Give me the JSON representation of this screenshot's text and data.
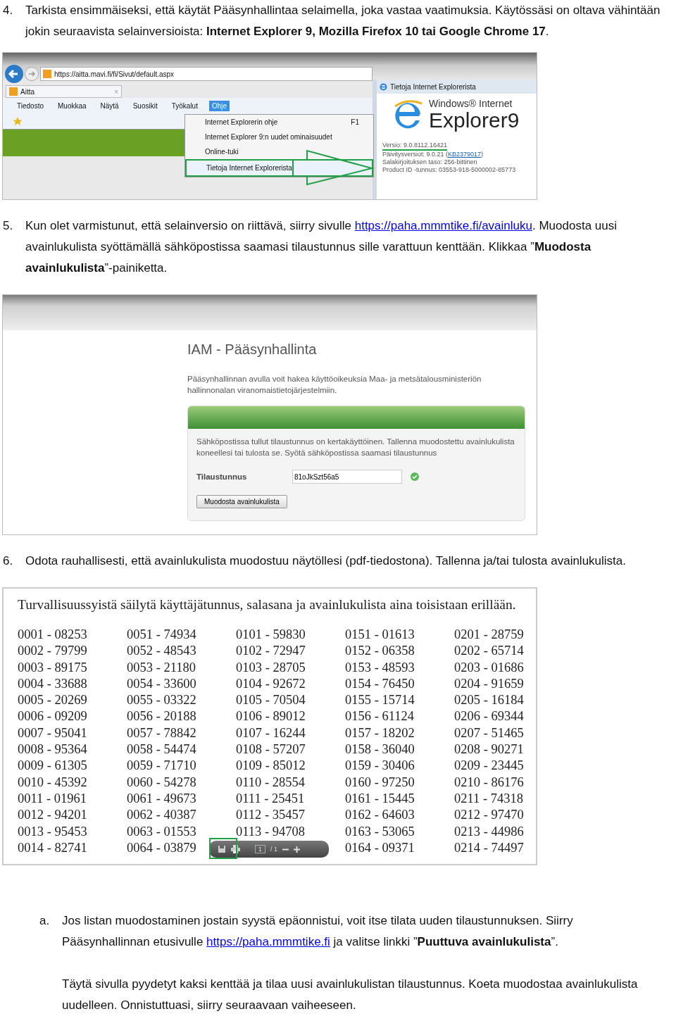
{
  "step_4": {
    "number": "4.",
    "parts": [
      {
        "kind": "text",
        "text": "Tarkista ensimmäiseksi, että käytät Pääsynhallintaa selaimella, joka vastaa vaatimuksia. Käytössäsi on oltava vähintään jokin seuraavista selainversioista: **Internet Explorer 9, Mozilla Firefox 10 tai Google Chrome 17**."
      }
    ]
  },
  "browser_screenshot": {
    "url": "https://aitta.mavi.fi/fi/Sivut/default.aspx",
    "tab": "Aitta",
    "tab_close": "×",
    "menu": [
      {
        "label": "Tiedosto",
        "selected": false
      },
      {
        "label": "Muokkaa",
        "selected": false
      },
      {
        "label": "Näytä",
        "selected": false
      },
      {
        "label": "Suosikit",
        "selected": false
      },
      {
        "label": "Työkalut",
        "selected": false
      },
      {
        "label": "Ohje",
        "selected": true
      }
    ],
    "dropdown": [
      {
        "label": "Internet Explorerin ohje",
        "shortcut": "F1",
        "highlighted": false
      },
      {
        "label": "Internet Explorer 9:n uudet ominaisuudet",
        "highlighted": false
      },
      {
        "label": "Online-tuki",
        "highlighted": false
      },
      {
        "label": "Tietoja Internet Explorerista",
        "highlighted": true
      }
    ],
    "about_dialog": {
      "title": "Tietoja Internet Explorerista",
      "logo_small": "Windows® Internet",
      "logo_large": "Explorer9",
      "version": "Versio: 9.0.8112.16421",
      "updates": "Päivitysversiot: 9.0.21 (",
      "updates_link": "KB2379017",
      "updates_end": ")",
      "encryption": "Salakirjoituksen taso: 256-bittinen",
      "product_id": "Product ID -tunnus: 03553-918-5000002-85773"
    }
  },
  "step_5": {
    "number": "5.",
    "parts": [
      {
        "kind": "text",
        "text": "Kun olet varmistunut, että selainversio on riittävä, siirry sivulle "
      },
      {
        "kind": "link",
        "text": "https://paha.mmmtike.fi/avainluku"
      },
      {
        "kind": "text",
        "text": ". Muodosta uusi avainlukulista syöttämällä sähköpostissa saamasi tilaustunnus sille varattuun kenttään. Klikkaa ”**Muodosta avainlukulista**”-painiketta."
      }
    ]
  },
  "iam_screenshot": {
    "title": "IAM - Pääsynhallinta",
    "intro": "Pääsynhallinnan avulla voit hakea käyttöoikeuksia Maa- ja metsätalousministeriön hallinnonalan viranomaistietojärjestelmiin.",
    "notice": "Sähköpostissa tullut tilaustunnus on kertakäyttöinen. Tallenna muodostettu avainlukulista koneellesi tai tulosta se. Syötä sähköpostissa saamasi tilaustunnus",
    "field_label": "Tilaustunnus",
    "field_value": "81oJkSzt56a5",
    "valid": true,
    "button": "Muodosta avainlukulista"
  },
  "step_6": {
    "number": "6.",
    "parts": [
      {
        "kind": "text",
        "text": "Odota rauhallisesti, että avainlukulista muodostuu näytöllesi (pdf-tiedostona). Tallenna ja/tai tulosta avainlukulista."
      }
    ]
  },
  "pdf_screenshot": {
    "heading": "Turvallisuussyistä säilytä käyttäjätunnus, salasana ja avainlukulista aina toisistaan erillään.",
    "columns": [
      [
        "0001 - 08253",
        "0002 - 79799",
        "0003 - 89175",
        "0004 - 33688",
        "0005 - 20269",
        "0006 - 09209",
        "0007 - 95041",
        "0008 - 95364",
        "0009 - 61305",
        "0010 - 45392",
        "0011 - 01961",
        "0012 - 94201",
        "0013 - 95453",
        "0014 - 82741"
      ],
      [
        "0051 - 74934",
        "0052 - 48543",
        "0053 - 21180",
        "0054 - 33600",
        "0055 - 03322",
        "0056 - 20188",
        "0057 - 78842",
        "0058 - 54474",
        "0059 - 71710",
        "0060 - 54278",
        "0061 - 49673",
        "0062 - 40387",
        "0063 - 01553",
        "0064 - 03879"
      ],
      [
        "0101 - 59830",
        "0102 - 72947",
        "0103 - 28705",
        "0104 - 92672",
        "0105 - 70504",
        "0106 - 89012",
        "0107 - 16244",
        "0108 - 57207",
        "0109 - 85012",
        "0110 - 28554",
        "0111 - 25451",
        "0112 - 35457",
        "0113 - 94708"
      ],
      [
        "0151 - 01613",
        "0152 - 06358",
        "0153 - 48593",
        "0154 - 76450",
        "0155 - 15714",
        "0156 - 61124",
        "0157 - 18202",
        "0158 - 36040",
        "0159 - 30406",
        "0160 - 97250",
        "0161 - 15445",
        "0162 - 64603",
        "0163 - 53065",
        "0164 - 09371"
      ],
      [
        "0201 - 28759",
        "0202 - 65714",
        "0203 - 01686",
        "0204 - 91659",
        "0205 - 16184",
        "0206 - 69344",
        "0207 - 51465",
        "0208 - 90271",
        "0209 - 23445",
        "0210 - 86176",
        "0211 - 74318",
        "0212 - 97470",
        "0213 - 44986",
        "0214 - 74497"
      ]
    ],
    "toolbar_page": "1",
    "toolbar_total": "/ 1"
  },
  "step_a": {
    "number": "a.",
    "parts": [
      {
        "kind": "text",
        "text": "Jos listan muodostaminen jostain syystä epäonnistui, voit itse tilata uuden tilaustunnuksen. Siirry Pääsynhallinnan etusivulle "
      },
      {
        "kind": "link",
        "text": "https://paha.mmmtike.fi"
      },
      {
        "kind": "text",
        "text": " ja valitse linkki ”**Puuttuva avainlukulista**”."
      }
    ],
    "note": "Täytä sivulla pyydetyt kaksi kenttää ja tilaa uusi avainlukulistan tilaustunnus. Koeta muodostaa avainlukulista uudelleen. Onnistuttuasi, siirry seuraavaan vaiheeseen."
  }
}
